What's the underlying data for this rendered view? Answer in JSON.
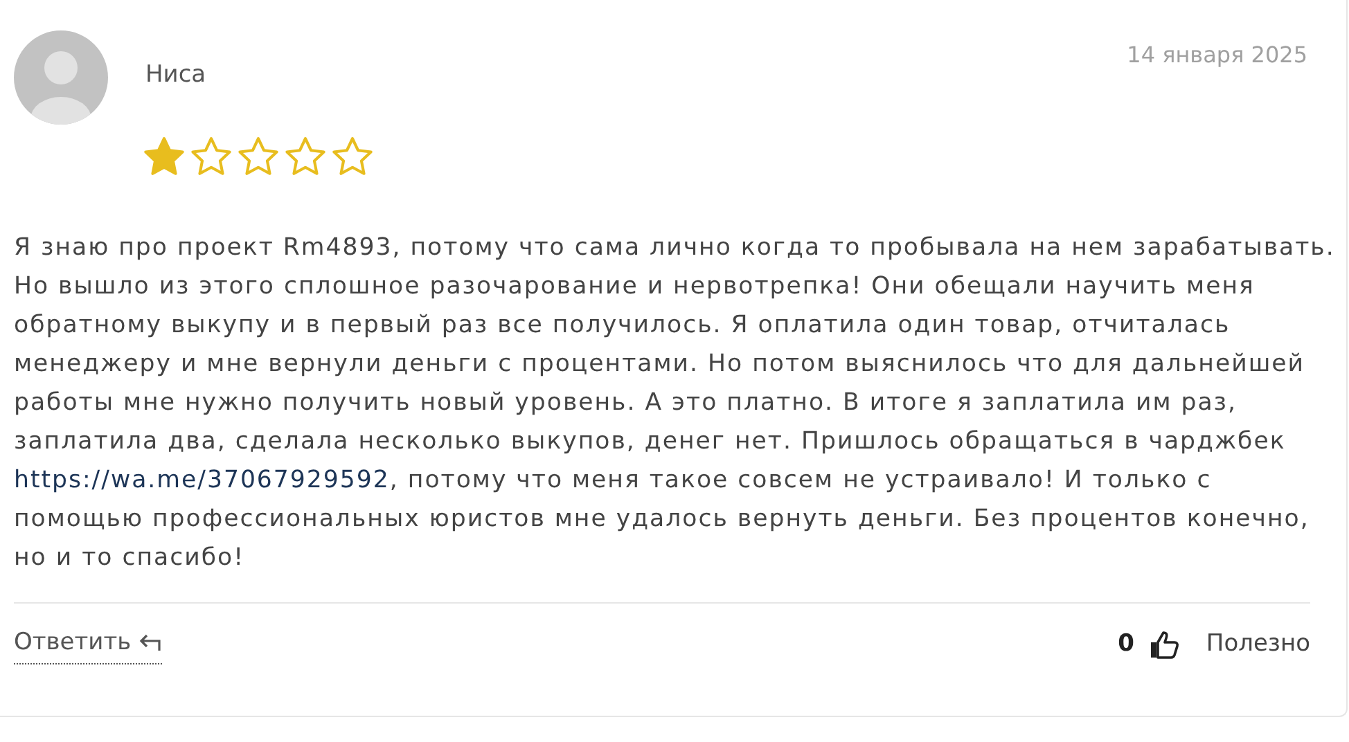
{
  "review": {
    "author": "Ниса",
    "date": "14 января 2025",
    "stars": 1,
    "body": [
      {
        "kind": "text",
        "text": "Я знаю про проект Rm4893, потому что сама лично когда то пробывала на нем зарабатывать. Но вышло из этого сплошное разочарование и нервотрепка! Они обещали научить меня обратному выкупу и в первый раз все получилось. Я оплатила один товар, отчиталась менеджеру и мне вернули деньги с процентами. Но потом выяснилось что для дальнейшей работы мне нужно получить новый уровень. А это платно. В итоге я заплатила им раз, заплатила два, сделала несколько выкупов, денег нет. Пришлось обращаться в чарджбек "
      },
      {
        "kind": "link",
        "text": "https://wa.me/37067929592"
      },
      {
        "kind": "text",
        "text": ", потому что меня такое совсем не устраивало! И только с помощью профессиональных юристов мне удалось вернуть деньги. Без процентов конечно, но и то спасибо!"
      }
    ],
    "reply": "Ответить",
    "helpful_count": "0",
    "helpful_label": "Полезно"
  }
}
